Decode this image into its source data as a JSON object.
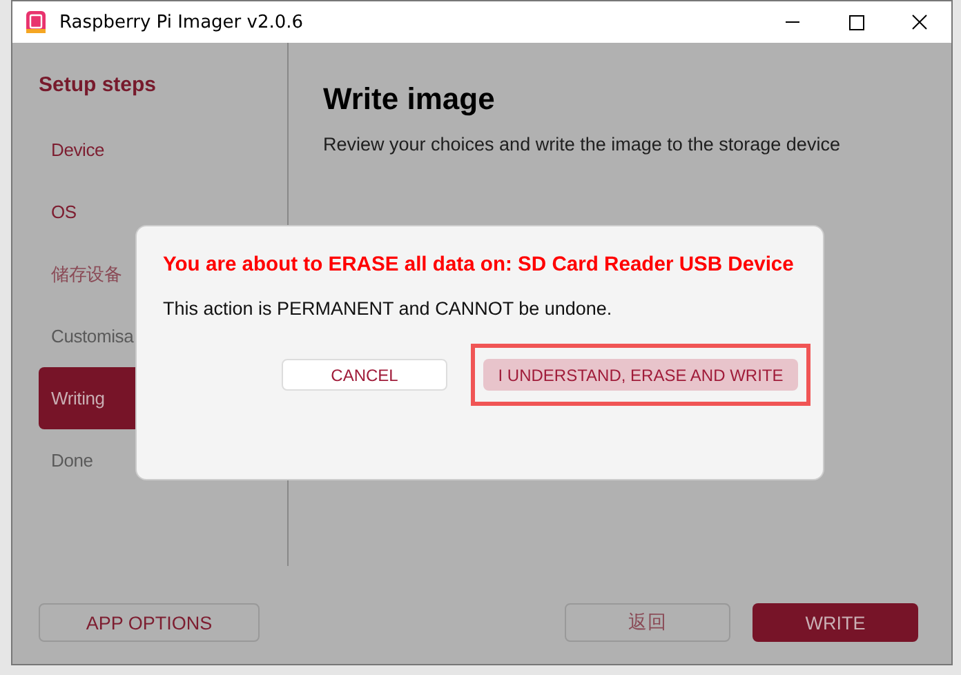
{
  "window": {
    "title": "Raspberry Pi Imager v2.0.6"
  },
  "sidebar": {
    "heading": "Setup steps",
    "items": [
      {
        "label": "Device",
        "selected": false,
        "completed": true
      },
      {
        "label": "OS",
        "selected": false,
        "completed": true
      },
      {
        "label": "储存设备",
        "selected": false,
        "completed": true
      },
      {
        "label": "Customisa",
        "selected": false,
        "completed": false
      },
      {
        "label": "Writing",
        "selected": true,
        "completed": false
      },
      {
        "label": "Done",
        "selected": false,
        "completed": false
      }
    ]
  },
  "main": {
    "title": "Write image",
    "subtitle": "Review your choices and write the image to the storage device"
  },
  "footer": {
    "app_options": "APP OPTIONS",
    "back": "返回",
    "write": "WRITE"
  },
  "dialog": {
    "title": "You are about to ERASE all data on: SD Card Reader USB Device",
    "message": "This action is PERMANENT and CANNOT be undone.",
    "buttons": [
      {
        "label": "CANCEL",
        "kind": "secondary",
        "focused": false
      },
      {
        "label": "I UNDERSTAND, ERASE AND WRITE",
        "kind": "primary",
        "focused": true
      }
    ]
  }
}
